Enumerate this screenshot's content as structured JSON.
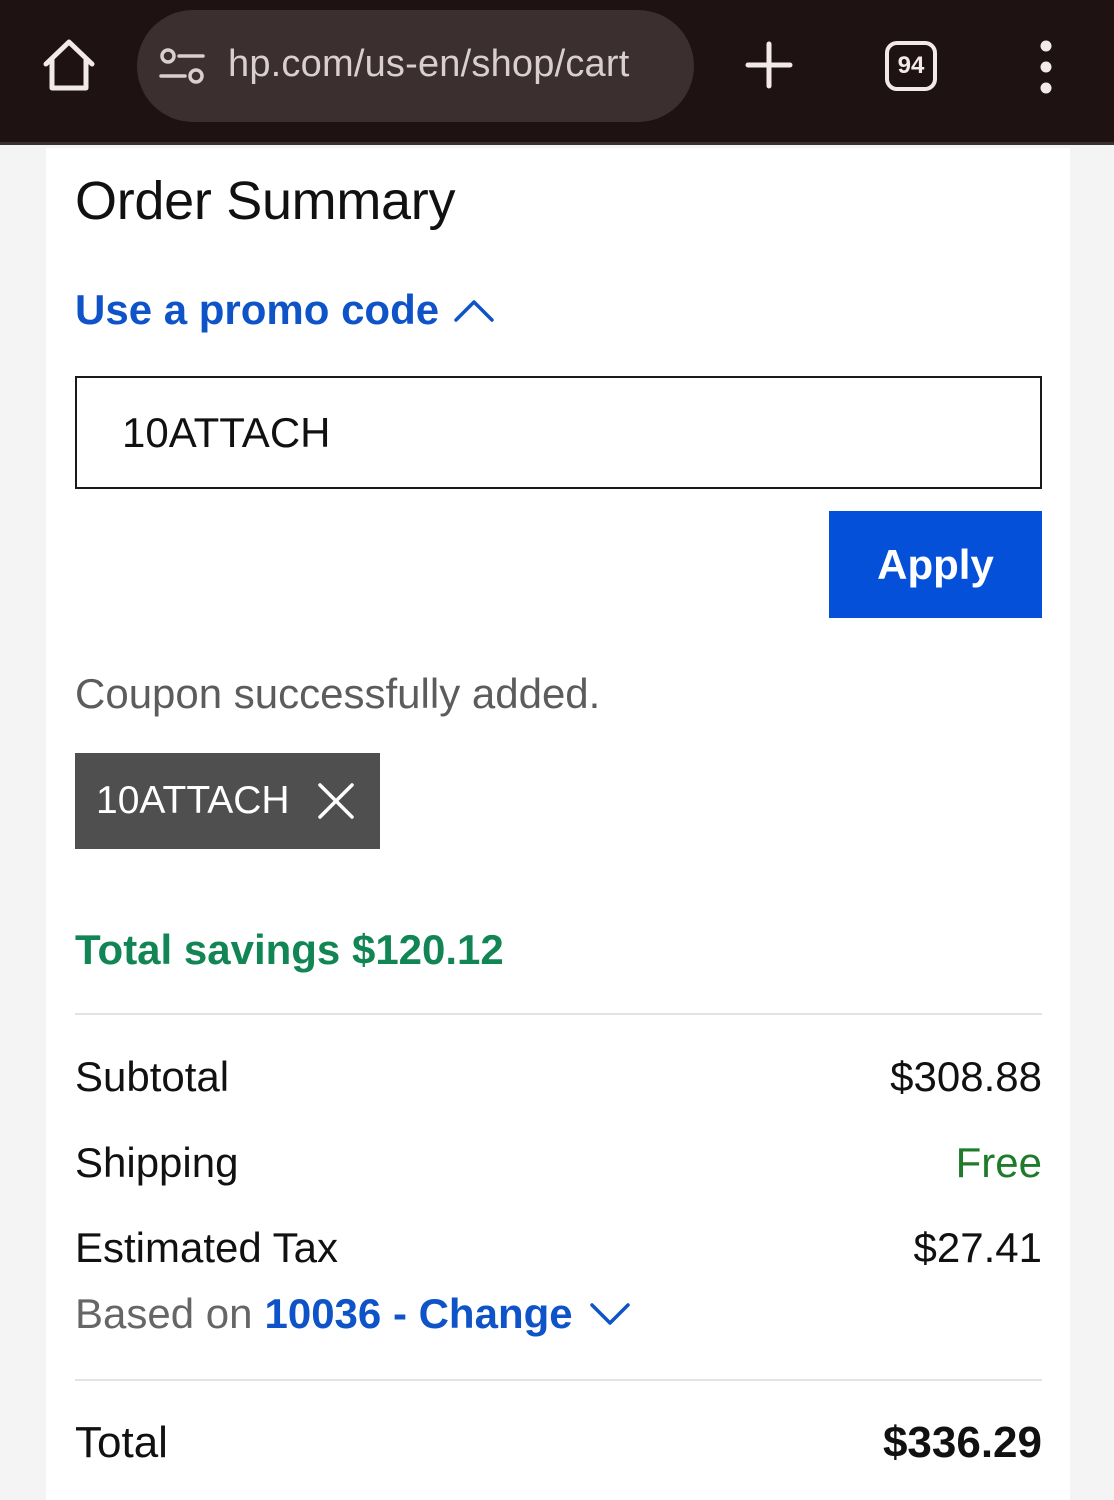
{
  "browser": {
    "url": "hp.com/us-en/shop/cart",
    "tab_count": "94",
    "colors": {
      "bar_bg": "#1e1212",
      "pill_bg": "#3b2f2f"
    }
  },
  "summary": {
    "title": "Order Summary",
    "promo_toggle_label": "Use a promo code",
    "promo_input_value": "10ATTACH",
    "apply_label": "Apply",
    "coupon_message": "Coupon successfully added.",
    "applied_coupon": "10ATTACH",
    "savings_text": "Total savings $120.12"
  },
  "totals": {
    "subtotal_label": "Subtotal",
    "subtotal_value": "$308.88",
    "shipping_label": "Shipping",
    "shipping_value": "Free",
    "tax_label": "Estimated Tax",
    "tax_value": "$27.41",
    "tax_basis_prefix": "Based on",
    "tax_zip_link": "10036 - Change",
    "total_label": "Total",
    "total_value": "$336.29"
  },
  "colors": {
    "link_blue": "#0e53c7",
    "apply_blue": "#0550d9",
    "savings_green": "#128554",
    "free_green": "#1d7b2a",
    "chip_gray": "#4f4f4f"
  },
  "icons": {
    "home": "home-icon",
    "site_settings": "tune-icon",
    "new_tab": "plus-icon",
    "tabs": "tab-switcher-icon",
    "menu": "more-vert-icon",
    "promo_toggle": "chevron-up-icon",
    "chip_remove": "close-icon",
    "zip_change": "chevron-down-icon"
  }
}
